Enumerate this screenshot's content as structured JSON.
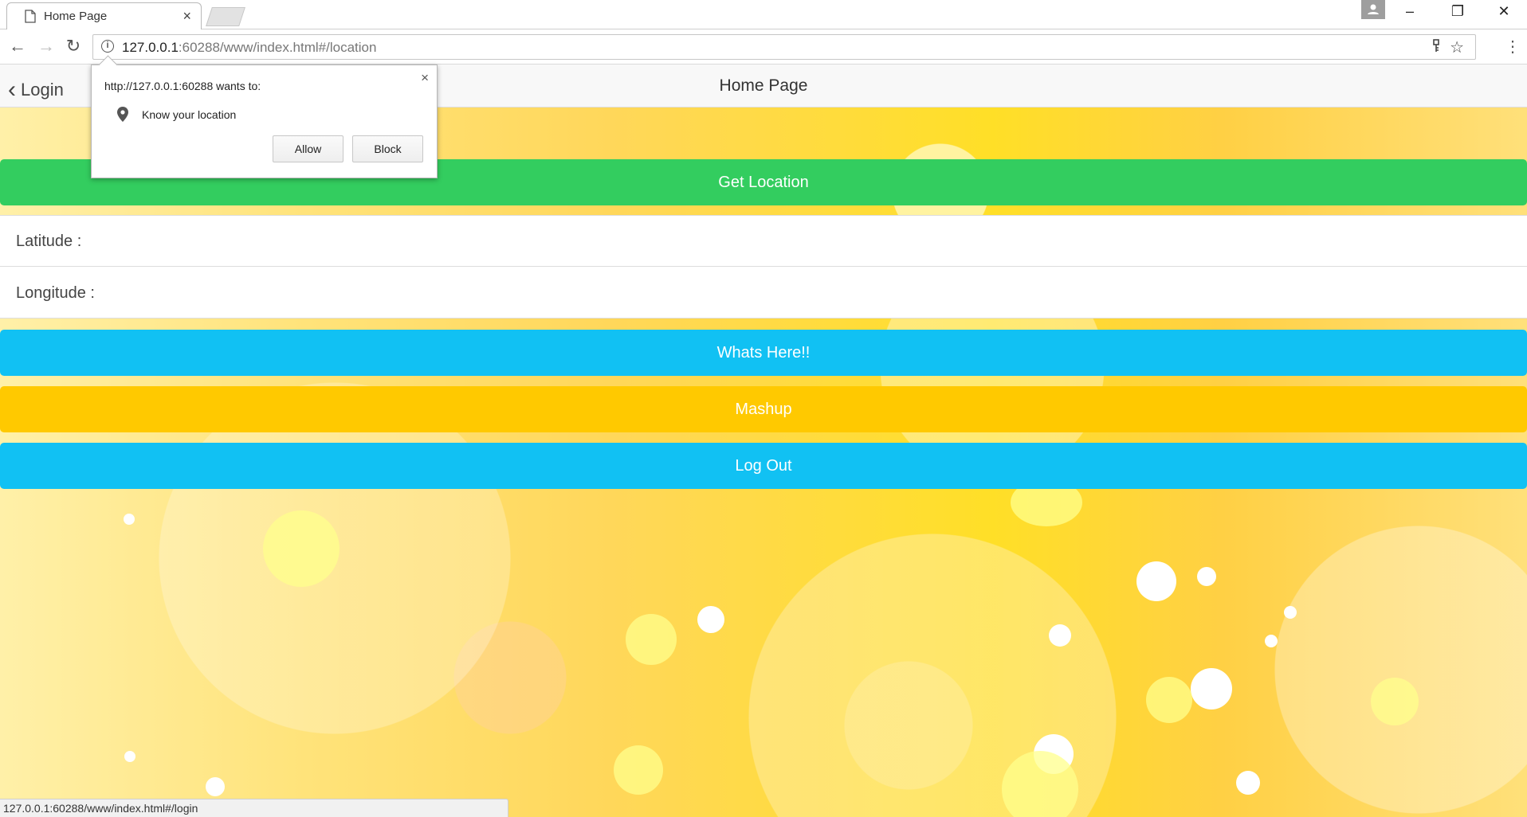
{
  "browser": {
    "tab_title": "Home Page",
    "tab_close": "×",
    "url_host": "127.0.0.1",
    "url_rest": ":60288/www/index.html#/location",
    "window_controls": {
      "minimize": "–",
      "restore": "❐",
      "close": "✕"
    },
    "back": "←",
    "forward": "→",
    "reload": "↻",
    "menu": "⋮"
  },
  "app": {
    "back_label": "Login",
    "back_chevron": "‹",
    "title": "Home Page",
    "get_location": "Get Location",
    "latitude_label": "Latitude :",
    "longitude_label": "Longitude :",
    "whats_here": "Whats Here!!",
    "mashup": "Mashup",
    "logout": "Log Out"
  },
  "permission_popup": {
    "origin": "http://127.0.0.1:60288 wants to:",
    "request": "Know your location",
    "allow": "Allow",
    "block": "Block",
    "close": "×"
  },
  "status_bar": {
    "text": "127.0.0.1:60288/www/index.html#/login"
  },
  "colors": {
    "get_location": "#33cd5f",
    "whats_here": "#11c1f3",
    "mashup": "#ffc900",
    "logout": "#11c1f3"
  }
}
